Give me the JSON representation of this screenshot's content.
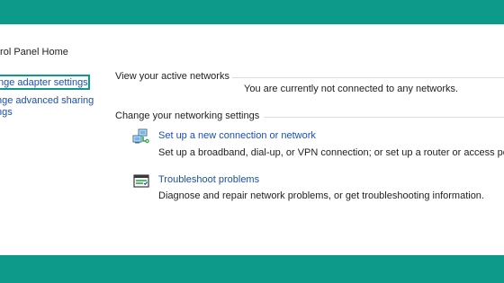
{
  "sidebar": {
    "home_label": "trol Panel Home",
    "items": [
      {
        "label": "nge adapter settings"
      },
      {
        "label_line1": "nge advanced sharing",
        "label_line2": "ngs"
      }
    ]
  },
  "sections": {
    "active_networks": {
      "title": "View your active networks",
      "status": "You are currently not connected to any networks."
    },
    "change_settings": {
      "title": "Change your networking settings",
      "tasks": [
        {
          "icon": "network-connection-icon",
          "link": "Set up a new connection or network",
          "description": "Set up a broadband, dial-up, or VPN connection; or set up a router or access point"
        },
        {
          "icon": "troubleshoot-icon",
          "link": "Troubleshoot problems",
          "description": "Diagnose and repair network problems, or get troubleshooting information."
        }
      ]
    }
  },
  "colors": {
    "band": "#0e9a8b",
    "link": "#1a4fb0",
    "selection_border": "#0e9a8b"
  }
}
